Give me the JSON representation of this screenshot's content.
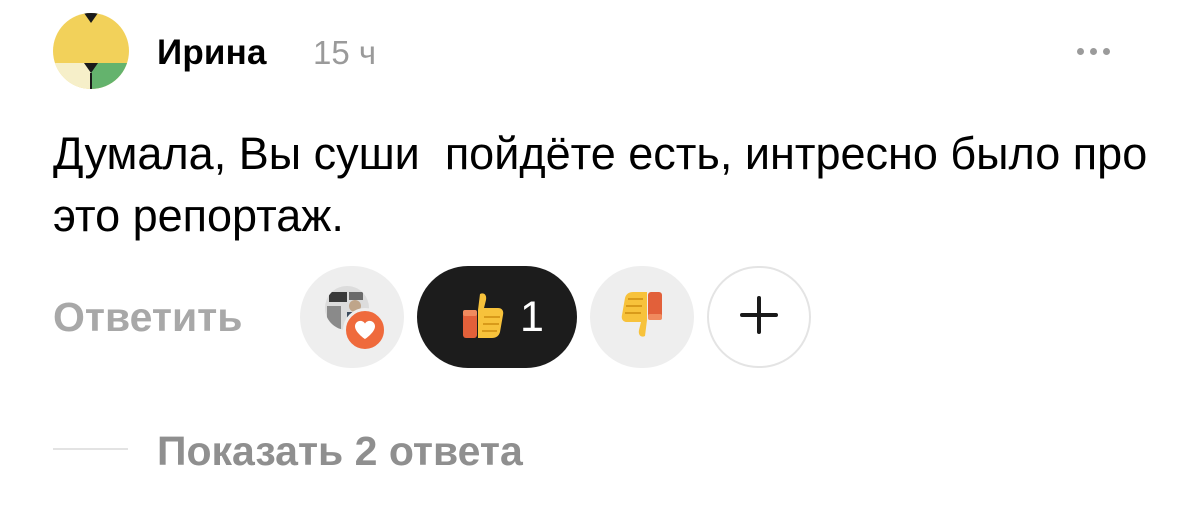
{
  "comment": {
    "author": "Ирина",
    "time": "15 ч",
    "text": "Думала, Вы суши  пойдёте есть, интресно было про это репортаж."
  },
  "actions": {
    "reply_label": "Ответить",
    "like_count": "1",
    "add_reaction_symbol": "+"
  },
  "replies": {
    "show_label": "Показать 2 ответа"
  },
  "icons": {
    "more": "more-dots-icon",
    "reaction_heart": "heart-icon",
    "like": "thumbs-up-icon",
    "dislike": "thumbs-down-icon",
    "add": "plus-icon"
  },
  "colors": {
    "avatar_yellow": "#f2d15a",
    "avatar_cream": "#f6efc9",
    "avatar_green": "#64b36d",
    "muted_text": "#9a9a9a",
    "like_chip": "#1c1c1c",
    "chip_bg": "#eeeeee",
    "heart": "#ef6a3c"
  }
}
